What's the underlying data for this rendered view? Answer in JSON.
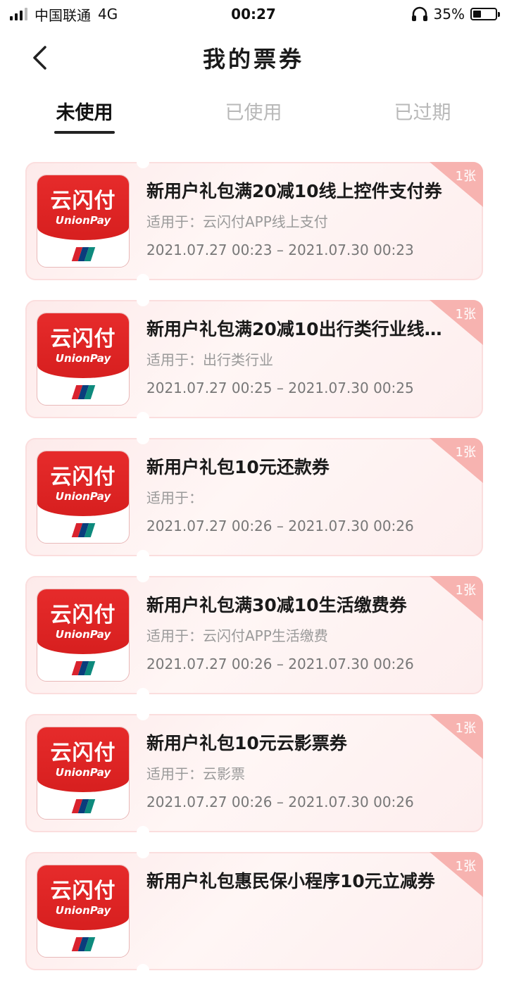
{
  "status": {
    "carrier": "中国联通",
    "network": "4G",
    "time": "00:27",
    "battery": "35%",
    "battery_level": 0.35
  },
  "header": {
    "title": "我的票券"
  },
  "tabs": [
    {
      "label": "未使用"
    },
    {
      "label": "已使用"
    },
    {
      "label": "已过期"
    }
  ],
  "logo": {
    "cn": "云闪付",
    "en": "UnionPay"
  },
  "coupons": [
    {
      "title": "新用户礼包满20减10线上控件支付券",
      "scope": "适用于：云闪付APP线上支付",
      "date": "2021.07.27 00:23 – 2021.07.30 00:23",
      "count": "1张"
    },
    {
      "title": "新用户礼包满20减10出行类行业线…",
      "scope": "适用于：出行类行业",
      "date": "2021.07.27 00:25 – 2021.07.30 00:25",
      "count": "1张"
    },
    {
      "title": "新用户礼包10元还款券",
      "scope": "适用于：",
      "date": "2021.07.27 00:26 – 2021.07.30 00:26",
      "count": "1张"
    },
    {
      "title": "新用户礼包满30减10生活缴费券",
      "scope": "适用于：云闪付APP生活缴费",
      "date": "2021.07.27 00:26 – 2021.07.30 00:26",
      "count": "1张"
    },
    {
      "title": "新用户礼包10元云影票券",
      "scope": "适用于：云影票",
      "date": "2021.07.27 00:26 – 2021.07.30 00:26",
      "count": "1张"
    },
    {
      "title": "新用户礼包惠民保小程序10元立减券",
      "scope": "",
      "date": "",
      "count": "1张"
    }
  ],
  "colors": {
    "accent": "#e62b2b",
    "corner": "#f7b3b0",
    "card_bg": "#fdeaea"
  },
  "icons": [
    "signal-icon",
    "headphones-icon",
    "battery-icon",
    "back-arrow-icon",
    "unionpay-mark-icon"
  ]
}
